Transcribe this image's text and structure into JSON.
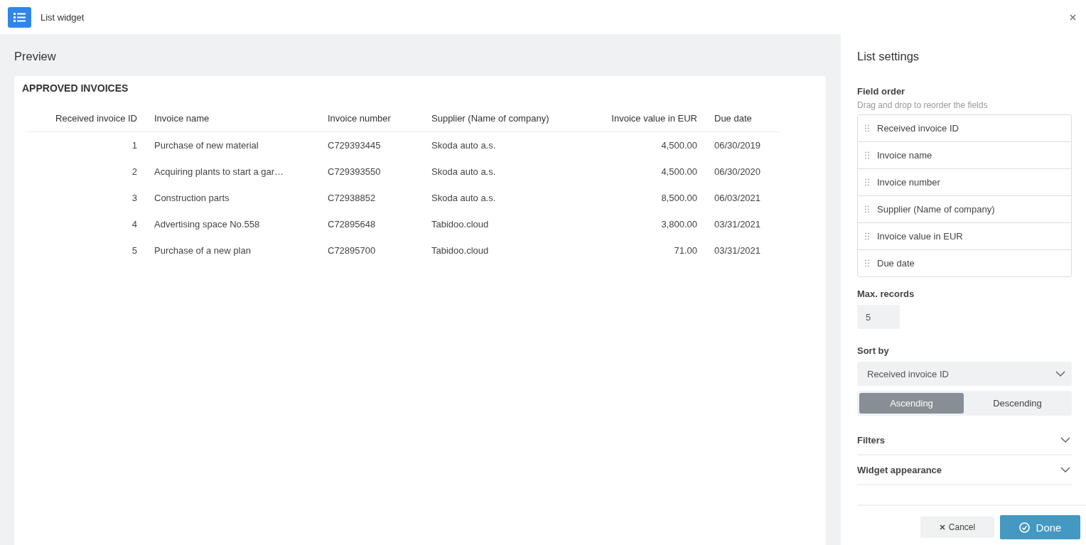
{
  "window": {
    "title": "List widget"
  },
  "preview": {
    "title": "Preview",
    "widget_title": "APPROVED INVOICES",
    "table": {
      "columns": [
        "Received invoice ID",
        "Invoice name",
        "Invoice number",
        "Supplier (Name of company)",
        "Invoice value in EUR",
        "Due date"
      ],
      "rows": [
        [
          "1",
          "Purchase of new material",
          "C729393445",
          "Skoda auto a.s.",
          "4,500.00",
          "06/30/2019"
        ],
        [
          "2",
          "Acquiring plants to start a gar…",
          "C729393550",
          "Skoda auto a.s.",
          "4,500.00",
          "06/30/2020"
        ],
        [
          "3",
          "Construction parts",
          "C72938852",
          "Skoda auto a.s.",
          "8,500.00",
          "06/03/2021"
        ],
        [
          "4",
          "Advertising space No.558",
          "C72895648",
          "Tabidoo.cloud",
          "3,800.00",
          "03/31/2021"
        ],
        [
          "5",
          "Purchase of a new plan",
          "C72895700",
          "Tabidoo.cloud",
          "71.00",
          "03/31/2021"
        ]
      ]
    }
  },
  "settings": {
    "title": "List settings",
    "field_order_label": "Field order",
    "field_order_hint": "Drag and drop to reorder the fields",
    "fields": [
      "Received invoice ID",
      "Invoice name",
      "Invoice number",
      "Supplier (Name of company)",
      "Invoice value in EUR",
      "Due date"
    ],
    "max_records_label": "Max. records",
    "max_records": "5",
    "sort_by_label": "Sort by",
    "sort_by": "Received invoice ID",
    "sort_direction": [
      {
        "label": "Ascending",
        "selected": true
      },
      {
        "label": "Descending",
        "selected": false
      }
    ],
    "sections": [
      {
        "label": "Filters",
        "expanded": false
      },
      {
        "label": "Widget appearance",
        "expanded": false
      }
    ]
  },
  "buttons": {
    "cancel": "Cancel",
    "done": "Done"
  }
}
